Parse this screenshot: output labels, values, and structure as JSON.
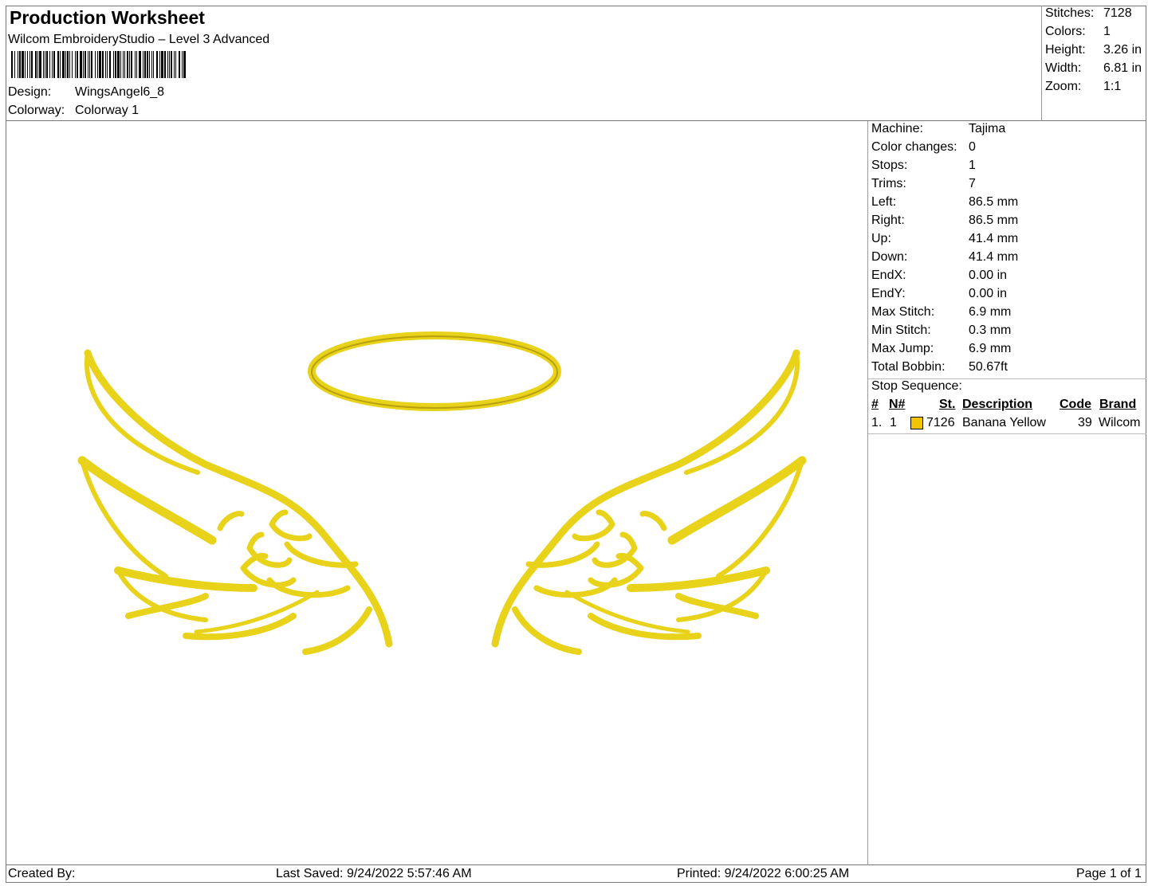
{
  "header": {
    "title": "Production Worksheet",
    "software": "Wilcom EmbroideryStudio – Level 3 Advanced",
    "design_label": "Design:",
    "design_value": "WingsAngel6_8",
    "colorway_label": "Colorway:",
    "colorway_value": "Colorway 1"
  },
  "summary": {
    "stitches_label": "Stitches:",
    "stitches_value": "7128",
    "colors_label": "Colors:",
    "colors_value": "1",
    "height_label": "Height:",
    "height_value": "3.26 in",
    "width_label": "Width:",
    "width_value": "6.81 in",
    "zoom_label": "Zoom:",
    "zoom_value": "1:1"
  },
  "machine_info": [
    {
      "label": "Machine:",
      "value": "Tajima"
    },
    {
      "label": "Color changes:",
      "value": "0"
    },
    {
      "label": "Stops:",
      "value": "1"
    },
    {
      "label": "Trims:",
      "value": "7"
    },
    {
      "label": "Left:",
      "value": "86.5 mm"
    },
    {
      "label": "Right:",
      "value": "86.5 mm"
    },
    {
      "label": "Up:",
      "value": "41.4 mm"
    },
    {
      "label": "Down:",
      "value": "41.4 mm"
    },
    {
      "label": "EndX:",
      "value": "0.00 in"
    },
    {
      "label": "EndY:",
      "value": "0.00 in"
    },
    {
      "label": "Max Stitch:",
      "value": "6.9 mm"
    },
    {
      "label": "Min Stitch:",
      "value": "0.3 mm"
    },
    {
      "label": "Max Jump:",
      "value": "6.9 mm"
    },
    {
      "label": "Total Bobbin:",
      "value": "50.67ft"
    }
  ],
  "stop_sequence": {
    "title": "Stop Sequence:",
    "columns": [
      "#",
      "N#",
      "St.",
      "Description",
      "Code",
      "Brand"
    ],
    "rows": [
      {
        "index": "1.",
        "n": "1",
        "color": "#F5C400",
        "stitches": "7126",
        "description": "Banana Yellow",
        "code": "39",
        "brand": "Wilcom"
      }
    ]
  },
  "design_colors": {
    "thread": "#E8D21A",
    "thread_dark": "#B8A010"
  },
  "footer": {
    "created_by": "Created By:",
    "last_saved": "Last Saved: 9/24/2022 5:57:46 AM",
    "printed": "Printed: 9/24/2022 6:00:25 AM",
    "page": "Page 1 of 1"
  }
}
